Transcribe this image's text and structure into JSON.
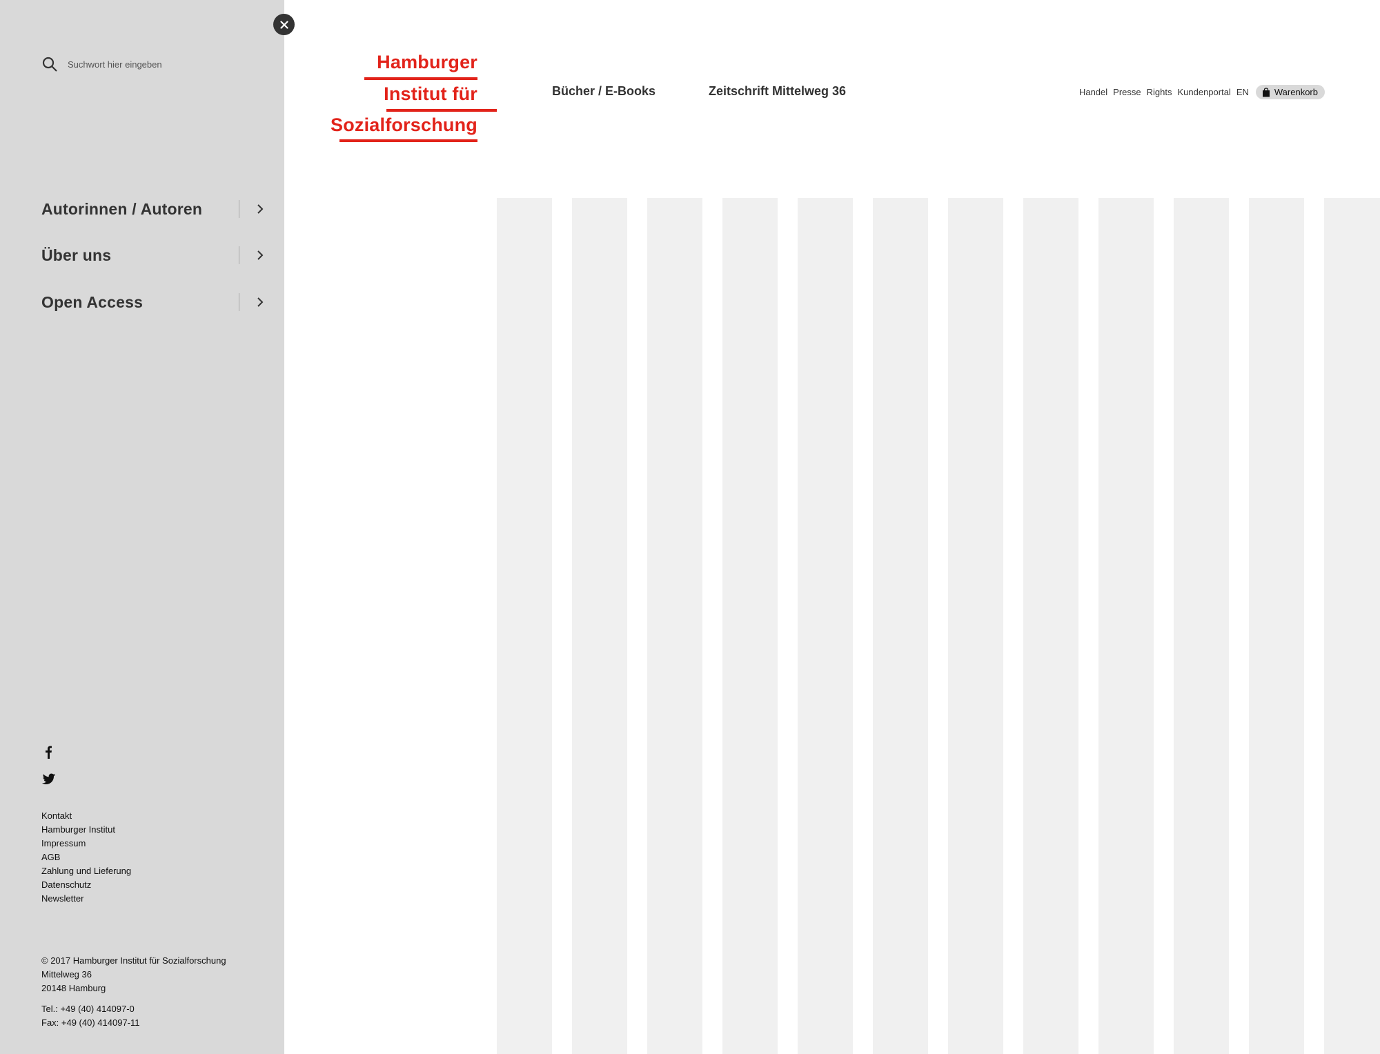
{
  "sidebar": {
    "close_label": "×",
    "search": {
      "placeholder": "Suchwort hier eingeben",
      "icon": "search-icon"
    },
    "nav_items": [
      {
        "label": "Autorinnen / Autoren",
        "icon": "chevron-right-icon"
      },
      {
        "label": "Über uns",
        "icon": "chevron-right-icon"
      },
      {
        "label": "Open Access",
        "icon": "chevron-right-icon"
      }
    ],
    "social": [
      "facebook-icon",
      "twitter-icon"
    ],
    "footer_links": [
      "Kontakt",
      "Hamburger Institut",
      "Impressum",
      "AGB",
      "Zahlung und Lieferung",
      "Datenschutz",
      "Newsletter"
    ],
    "address": [
      "© 2017 Hamburger Institut für Sozialforschung",
      "Mittelweg 36",
      "20148 Hamburg"
    ],
    "contact": [
      "Tel.: +49 (40) 414097-0",
      "Fax: +49 (40) 414097-11"
    ]
  },
  "header": {
    "logo": {
      "line1": "Hamburger",
      "line2": "Institut für",
      "line3": "Sozialforschung",
      "color": "#e2231a"
    },
    "main_nav": [
      "Bücher / E-Books",
      "Zeitschrift Mittelweg 36"
    ],
    "utility_links": [
      "Handel",
      "Presse",
      "Rights",
      "Kundenportal",
      "EN"
    ],
    "cart_label": "Warenkorb"
  },
  "colors": {
    "sidebar_bg": "#d9d9d9",
    "accent": "#e2231a",
    "placeholder_column": "#f0f0f0"
  }
}
